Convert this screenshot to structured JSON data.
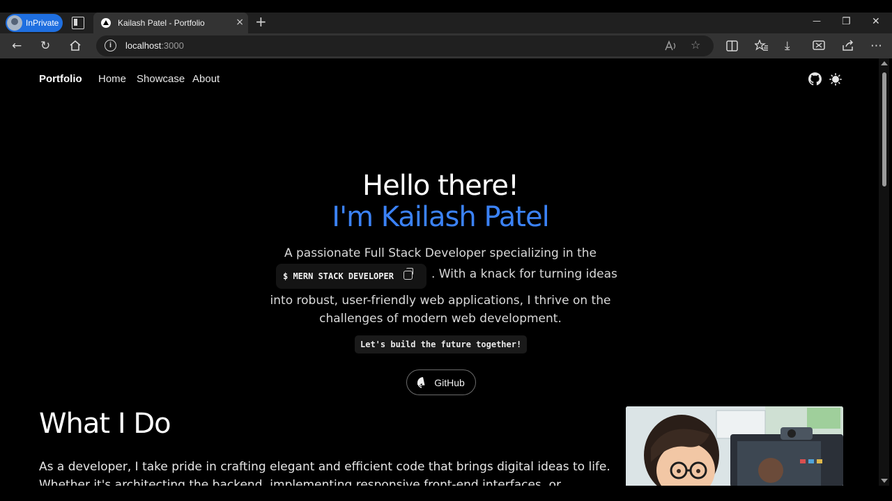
{
  "browser": {
    "inprivate_label": "InPrivate",
    "tab_title": "Kailash Patel - Portfolio",
    "tab_close": "×",
    "new_tab": "+",
    "url_host": "localhost",
    "url_port": ":3000",
    "min": "—",
    "restore": "❐",
    "close": "✕"
  },
  "nav": {
    "brand": "Portfolio",
    "links": [
      "Home",
      "Showcase",
      "About"
    ]
  },
  "hero": {
    "greeting": "Hello there!",
    "name_line": "I'm Kailash Patel",
    "para_line1": "A passionate Full Stack Developer specializing in the",
    "chip_text": "$ MERN STACK DEVELOPER",
    "para_line2_tail": ". With a knack for turning ideas",
    "para_line3": "into robust, user-friendly web applications, I thrive on the",
    "para_line4": "challenges of modern web development.",
    "tagline": "Let's build the future together!",
    "github_button": "GitHub"
  },
  "what_i_do": {
    "title": "What I Do",
    "text_line1": "As a developer, I take pride in crafting elegant and efficient code that brings digital ideas to life.",
    "text_line2": "Whether it's architecting the backend, implementing responsive front-end interfaces, or"
  },
  "colors": {
    "accent": "#3b82f6",
    "background": "#000000",
    "inprivate": "#1f6fe0"
  }
}
